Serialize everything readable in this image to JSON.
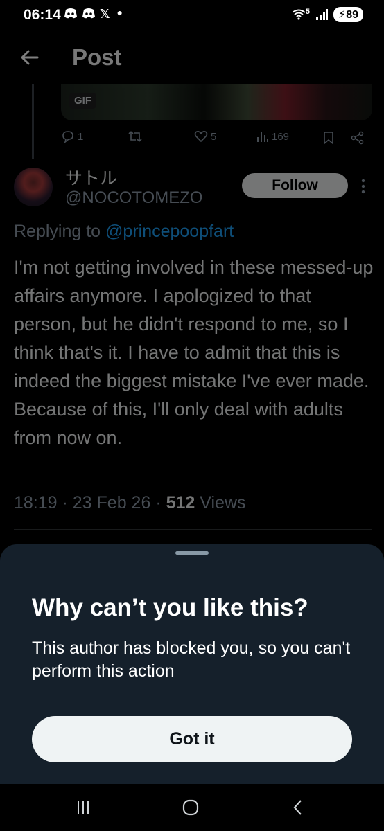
{
  "status_bar": {
    "time": "06:14",
    "notif_icons": [
      "discord-icon",
      "discord-icon",
      "x-icon"
    ],
    "x_glyph": "𝕏",
    "network_label": "5",
    "battery": "89"
  },
  "header": {
    "title": "Post"
  },
  "previous_post": {
    "gif_label": "GIF",
    "replies": "1",
    "retweets": "",
    "likes": "5",
    "views": "169"
  },
  "post": {
    "display_name": "サトル",
    "handle": "@NOCOTOMEZO",
    "follow_label": "Follow",
    "replying_prefix": "Replying to ",
    "replying_to": "@princepoopfart",
    "text": "I'm not getting involved in these messed-up affairs anymore. I apologized to that person, but he didn't respond to me, so I think that's it. I have to admit that this is indeed the biggest mistake I've ever made. Because of this, I'll only deal with adults from now on.",
    "time": "18:19",
    "date": "23 Feb 26",
    "views_count": "512",
    "views_label": "Views",
    "separator": " · "
  },
  "sheet": {
    "title": "Why can’t you like this?",
    "body": "This author has blocked you, so you can't perform this action",
    "button_label": "Got it"
  },
  "colors": {
    "background": "#000000",
    "sheet": "#15202b",
    "link": "#1d9bf0",
    "muted": "#8b98a5"
  }
}
